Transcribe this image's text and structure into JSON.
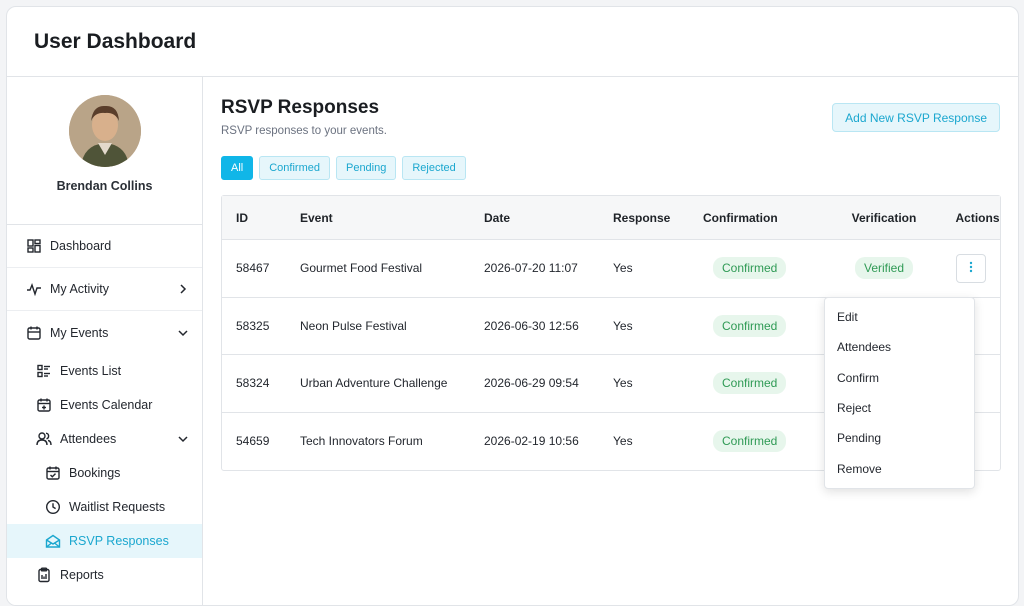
{
  "header": {
    "title": "User Dashboard"
  },
  "profile": {
    "name": "Brendan Collins"
  },
  "sidebar": {
    "dashboard": "Dashboard",
    "my_activity": "My Activity",
    "my_events": "My Events",
    "events_list": "Events List",
    "events_calendar": "Events Calendar",
    "attendees": "Attendees",
    "bookings": "Bookings",
    "waitlist_requests": "Waitlist Requests",
    "rsvp_responses": "RSVP Responses",
    "reports": "Reports"
  },
  "page": {
    "title": "RSVP Responses",
    "subtitle": "RSVP responses to your events.",
    "add_button": "Add New RSVP Response"
  },
  "filters": [
    "All",
    "Confirmed",
    "Pending",
    "Rejected"
  ],
  "table": {
    "headers": [
      "ID",
      "Event",
      "Date",
      "Response",
      "Confirmation",
      "Verification",
      "Actions"
    ],
    "rows": [
      {
        "id": "58467",
        "event": "Gourmet Food Festival",
        "date": "2026-07-20 11:07",
        "response": "Yes",
        "confirmation": "Confirmed",
        "verification": "Verified"
      },
      {
        "id": "58325",
        "event": "Neon Pulse Festival",
        "date": "2026-06-30 12:56",
        "response": "Yes",
        "confirmation": "Confirmed",
        "verification": ""
      },
      {
        "id": "58324",
        "event": "Urban Adventure Challenge",
        "date": "2026-06-29 09:54",
        "response": "Yes",
        "confirmation": "Confirmed",
        "verification": ""
      },
      {
        "id": "54659",
        "event": "Tech Innovators Forum",
        "date": "2026-02-19 10:56",
        "response": "Yes",
        "confirmation": "Confirmed",
        "verification": ""
      }
    ]
  },
  "dropdown": [
    "Edit",
    "Attendees",
    "Confirm",
    "Reject",
    "Pending",
    "Remove"
  ],
  "colors": {
    "accent": "#10b6e8",
    "accent_light": "#e6f6fb",
    "success": "#2f9a55",
    "success_bg": "#e7f6ec"
  }
}
